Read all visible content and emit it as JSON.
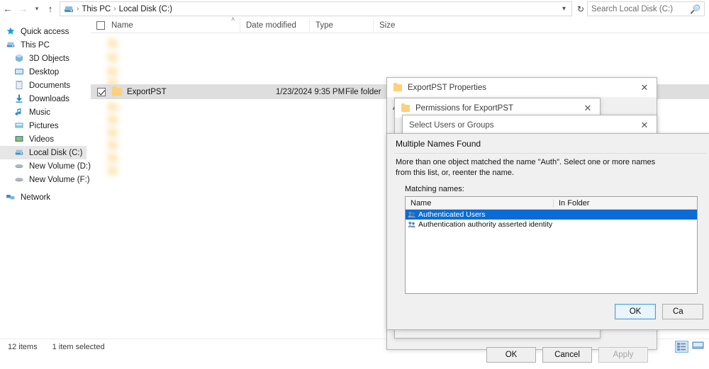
{
  "explorer": {
    "nav": {
      "back_icon": "arrow-left-icon",
      "forward_icon": "arrow-right-icon",
      "recent_icon": "chevron-down-icon",
      "up_icon": "arrow-up-icon"
    },
    "address": {
      "drive_icon": "local-disk-icon",
      "crumbs": [
        "This PC",
        "Local Disk (C:)"
      ],
      "separator": "›",
      "dropdown_icon": "chevron-down-icon",
      "refresh_icon": "refresh-icon"
    },
    "search": {
      "placeholder": "Search Local Disk (C:)",
      "icon": "search-icon"
    },
    "sidebar": {
      "items": [
        {
          "label": "Quick access",
          "icon": "star-icon",
          "indent": false,
          "selected": false
        },
        {
          "label": "This PC",
          "icon": "computer-icon",
          "indent": false,
          "selected": false
        },
        {
          "label": "3D Objects",
          "icon": "cube-icon",
          "indent": true,
          "selected": false
        },
        {
          "label": "Desktop",
          "icon": "desktop-icon",
          "indent": true,
          "selected": false
        },
        {
          "label": "Documents",
          "icon": "documents-icon",
          "indent": true,
          "selected": false
        },
        {
          "label": "Downloads",
          "icon": "download-icon",
          "indent": true,
          "selected": false
        },
        {
          "label": "Music",
          "icon": "music-note-icon",
          "indent": true,
          "selected": false
        },
        {
          "label": "Pictures",
          "icon": "pictures-icon",
          "indent": true,
          "selected": false
        },
        {
          "label": "Videos",
          "icon": "videos-icon",
          "indent": true,
          "selected": false
        },
        {
          "label": "Local Disk (C:)",
          "icon": "drive-icon",
          "indent": true,
          "selected": true
        },
        {
          "label": "New Volume (D:)",
          "icon": "volume-icon",
          "indent": true,
          "selected": false
        },
        {
          "label": "New Volume (F:)",
          "icon": "volume-icon",
          "indent": true,
          "selected": false
        },
        {
          "label": "Network",
          "icon": "network-icon",
          "indent": false,
          "selected": false
        }
      ]
    },
    "columns": {
      "name": "Name",
      "date_modified": "Date modified",
      "type": "Type",
      "size": "Size",
      "sort_caret": "˄"
    },
    "selected_row": {
      "name": "ExportPST",
      "date_modified": "1/23/2024 9:35 PM",
      "type": "File folder",
      "size": "",
      "checked": true
    },
    "status": {
      "items_count": "12 items",
      "selection": "1 item selected",
      "details_view_icon": "details-view-icon",
      "icons_view_icon": "large-icons-view-icon"
    }
  },
  "properties_dialog": {
    "title": "ExportPST Properties",
    "close_icon": "close-icon",
    "fragment_text": "A",
    "buttons": {
      "ok": "OK",
      "cancel": "Cancel",
      "apply": "Apply"
    }
  },
  "permissions_dialog": {
    "title": "Permissions for ExportPST",
    "close_icon": "close-icon"
  },
  "select_users_dialog": {
    "title": "Select Users or Groups",
    "close_icon": "close-icon"
  },
  "multiple_names_dialog": {
    "heading": "Multiple Names Found",
    "message_line1": "More than one object matched the name \"Auth\". Select one or more names",
    "message_line2": "from this list, or, reenter the name.",
    "list_label": "Matching names:",
    "columns": {
      "name": "Name",
      "in_folder": "In Folder"
    },
    "rows": [
      {
        "name": "Authenticated Users",
        "in_folder": "",
        "selected": true,
        "icon": "users-group-icon"
      },
      {
        "name": "Authentication authority asserted identity",
        "in_folder": "",
        "selected": false,
        "icon": "users-group-icon"
      }
    ],
    "buttons": {
      "ok": "OK",
      "cancel": "Ca"
    },
    "accent": "#0a6cd4"
  }
}
